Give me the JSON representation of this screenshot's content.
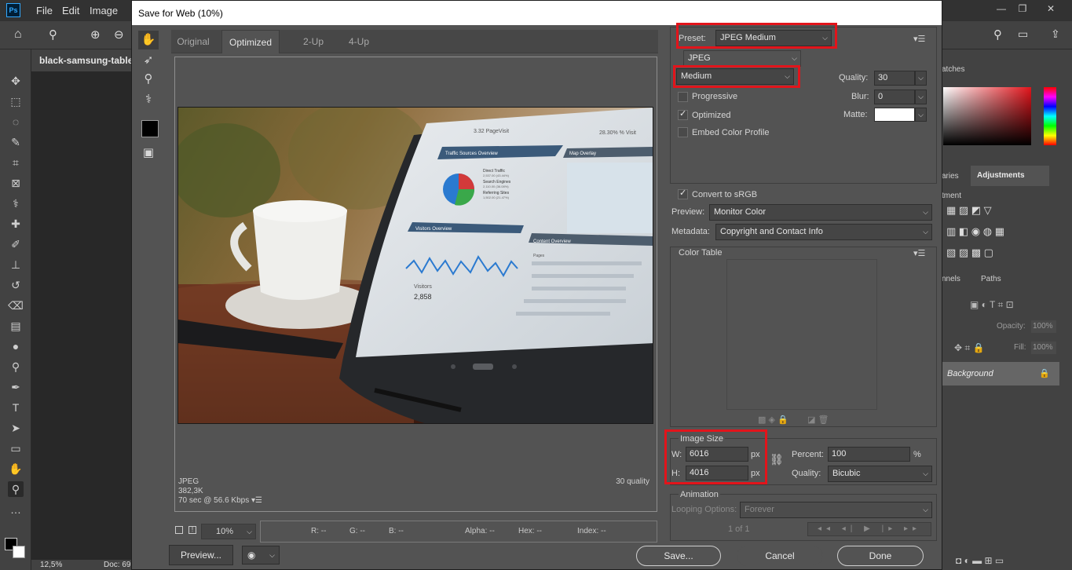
{
  "ps": {
    "menu": [
      "File",
      "Edit",
      "Image"
    ],
    "doc_tab": "black-samsung-tablet-",
    "zoom": "12,5%",
    "doc_info": "Doc: 69",
    "right_tabs": {
      "swatches": "atches",
      "libraries": "aries",
      "adjustments": "Adjustments",
      "channels": "nnels",
      "paths": "Paths"
    },
    "add_adjustment": "tment",
    "opacity_label": "Opacity:",
    "opacity_value": "100%",
    "fill_label": "Fill:",
    "fill_value": "100%",
    "layer_name": "Background"
  },
  "dialog": {
    "title": "Save for Web (10%)",
    "tabs": [
      "Original",
      "Optimized",
      "2-Up",
      "4-Up"
    ],
    "status": {
      "format": "JPEG",
      "size": "382,3K",
      "time": "70 sec @ 56.6 Kbps",
      "quality": "30 quality"
    },
    "zoom_value": "10%",
    "readouts": {
      "r": "R: --",
      "g": "G: --",
      "b": "B: --",
      "alpha": "Alpha: --",
      "hex": "Hex: --",
      "index": "Index: --"
    },
    "buttons": {
      "preview": "Preview...",
      "save": "Save...",
      "cancel": "Cancel",
      "done": "Done"
    }
  },
  "settings": {
    "preset_label": "Preset:",
    "preset_value": "JPEG Medium",
    "format_value": "JPEG",
    "quality_preset": "Medium",
    "quality_label": "Quality:",
    "quality_value": "30",
    "blur_label": "Blur:",
    "blur_value": "0",
    "matte_label": "Matte:",
    "progressive": "Progressive",
    "optimized": "Optimized",
    "embed_profile": "Embed Color Profile",
    "convert_srgb": "Convert to sRGB",
    "preview_label": "Preview:",
    "preview_value": "Monitor Color",
    "metadata_label": "Metadata:",
    "metadata_value": "Copyright and Contact Info",
    "color_table": "Color Table",
    "image_size": "Image Size",
    "w_label": "W:",
    "w_value": "6016",
    "h_label": "H:",
    "h_value": "4016",
    "px": "px",
    "percent_label": "Percent:",
    "percent_value": "100",
    "percent_unit": "%",
    "resample_label": "Quality:",
    "resample_value": "Bicubic",
    "animation": "Animation",
    "looping_label": "Looping Options:",
    "looping_value": "Forever",
    "frame_counter": "1 of 1"
  },
  "photo_text": {
    "page_visits": "3.32 PageVisit",
    "percent": "28.30% % Visit",
    "traffic": "Traffic Sources Overview",
    "map": "Map Overlay",
    "direct": "Direct Traffic",
    "direct_val": "2,537.00 (43.44%)",
    "search": "Search Engines",
    "search_val": "2,110.00 (36.08%)",
    "referring": "Referring Sites",
    "referring_val": "1,502.00 (21.47%)",
    "visitors": "Visitors Overview",
    "content": "Content Overview",
    "pages": "Pages",
    "visits_label": "Visitors",
    "visits_value": "2,858"
  }
}
